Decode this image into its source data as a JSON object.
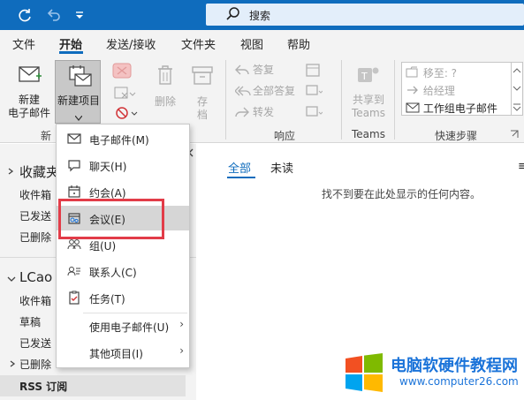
{
  "search": {
    "placeholder": "搜索"
  },
  "tabs": [
    {
      "label": "文件"
    },
    {
      "label": "开始"
    },
    {
      "label": "发送/接收"
    },
    {
      "label": "文件夹"
    },
    {
      "label": "视图"
    },
    {
      "label": "帮助"
    }
  ],
  "ribbon": {
    "new_email": "新建\n电子邮件",
    "new_item": "新建项目",
    "delete": "删除",
    "archive": "存\n档",
    "reply": "答复",
    "reply_all": "全部答复",
    "forward": "转发",
    "share_teams": "共享到\nTeams",
    "group_new": "新",
    "group_respond": "响应",
    "group_teams": "Teams",
    "group_quicksteps": "快速步骤",
    "quicksteps": [
      "移至: ?",
      "给经理",
      "工作组电子邮件"
    ]
  },
  "nav": {
    "favorites": "收藏夹",
    "inbox": "收件箱",
    "sent": "已发送",
    "deleted": "已删除",
    "account": "LCao",
    "drafts": "草稿",
    "rss": "RSS 订阅"
  },
  "list": {
    "tab_all": "全部",
    "tab_unread": "未读",
    "empty": "找不到要在此处显示的任何内容。"
  },
  "menu": {
    "items": [
      {
        "label": "电子邮件(M)",
        "icon": "mail-icon"
      },
      {
        "label": "聊天(H)",
        "icon": "chat-icon"
      },
      {
        "label": "约会(A)",
        "icon": "calendar-icon"
      },
      {
        "label": "会议(E)",
        "icon": "meeting-icon"
      },
      {
        "label": "组(U)",
        "icon": "group-icon"
      },
      {
        "label": "联系人(C)",
        "icon": "contact-icon"
      },
      {
        "label": "任务(T)",
        "icon": "task-icon"
      },
      {
        "label": "使用电子邮件(U)"
      },
      {
        "label": "其他项目(I)"
      }
    ]
  },
  "watermark": {
    "title": "电脑软硬件教程网",
    "url": "www.computer26.com"
  },
  "colors": {
    "accent": "#0f6cbd",
    "highlight": "#e23c48"
  }
}
